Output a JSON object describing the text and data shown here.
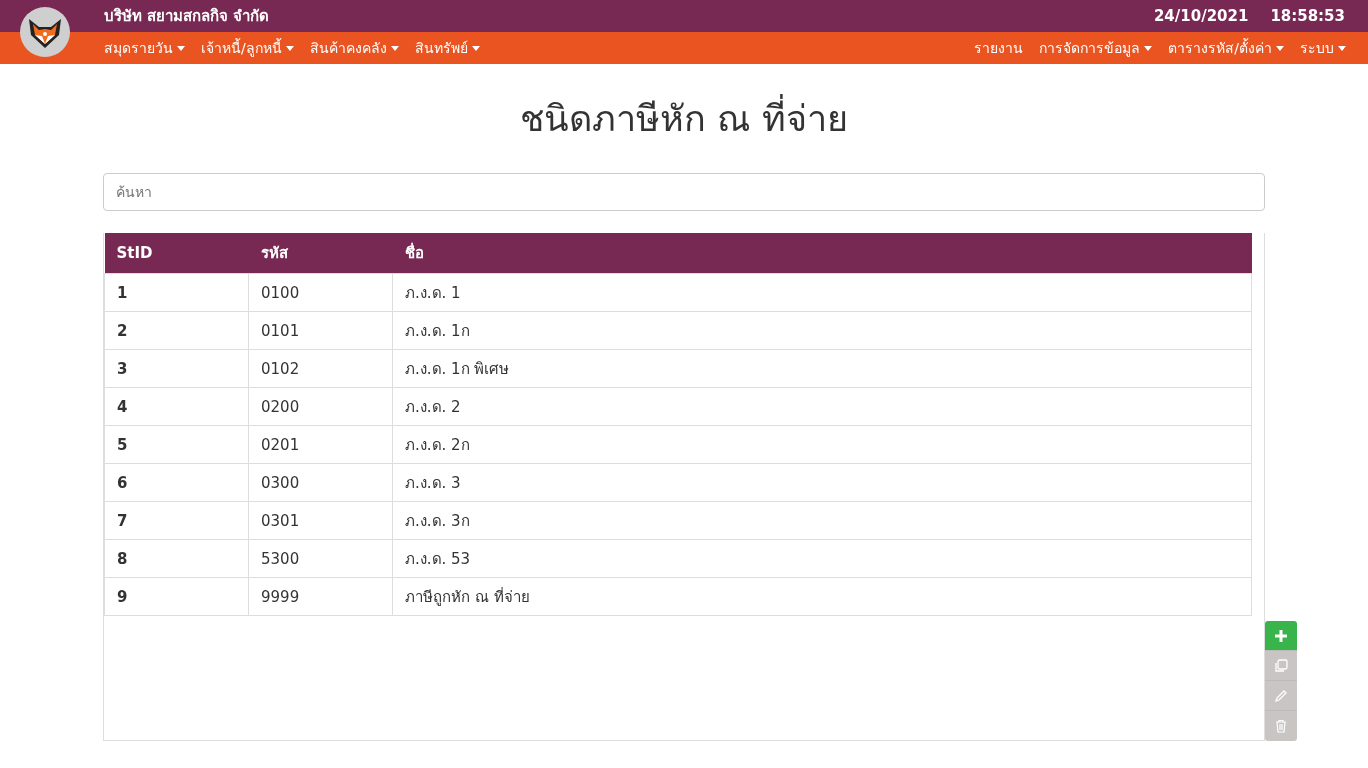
{
  "company": "บริษัท สยามสกลกิจ จำกัด",
  "date": "24/10/2021",
  "time": "18:58:53",
  "menu_left": [
    {
      "label": "สมุดรายวัน",
      "dropdown": true
    },
    {
      "label": "เจ้าหนี้/ลูกหนี้",
      "dropdown": true
    },
    {
      "label": "สินค้าคงคลัง",
      "dropdown": true
    },
    {
      "label": "สินทรัพย์",
      "dropdown": true
    }
  ],
  "menu_right": [
    {
      "label": "รายงาน",
      "dropdown": false
    },
    {
      "label": "การจัดการข้อมูล",
      "dropdown": true
    },
    {
      "label": "ตารางรหัส/ตั้งค่า",
      "dropdown": true
    },
    {
      "label": "ระบบ",
      "dropdown": true
    }
  ],
  "title": "ชนิดภาษีหัก ณ ที่จ่าย",
  "search": {
    "placeholder": "ค้นหา"
  },
  "table": {
    "columns": [
      "StID",
      "รหัส",
      "ชื่อ"
    ],
    "rows": [
      [
        "1",
        "0100",
        "ภ.ง.ด. 1"
      ],
      [
        "2",
        "0101",
        "ภ.ง.ด. 1ก"
      ],
      [
        "3",
        "0102",
        "ภ.ง.ด. 1ก พิเศษ"
      ],
      [
        "4",
        "0200",
        "ภ.ง.ด. 2"
      ],
      [
        "5",
        "0201",
        "ภ.ง.ด. 2ก"
      ],
      [
        "6",
        "0300",
        "ภ.ง.ด. 3"
      ],
      [
        "7",
        "0301",
        "ภ.ง.ด. 3ก"
      ],
      [
        "8",
        "5300",
        "ภ.ง.ด. 53"
      ],
      [
        "9",
        "9999",
        "ภาษีถูกหัก ณ ที่จ่าย"
      ]
    ]
  },
  "actions": [
    {
      "kind": "add",
      "disabled": false
    },
    {
      "kind": "copy",
      "disabled": true
    },
    {
      "kind": "edit",
      "disabled": true
    },
    {
      "kind": "delete",
      "disabled": true
    }
  ]
}
